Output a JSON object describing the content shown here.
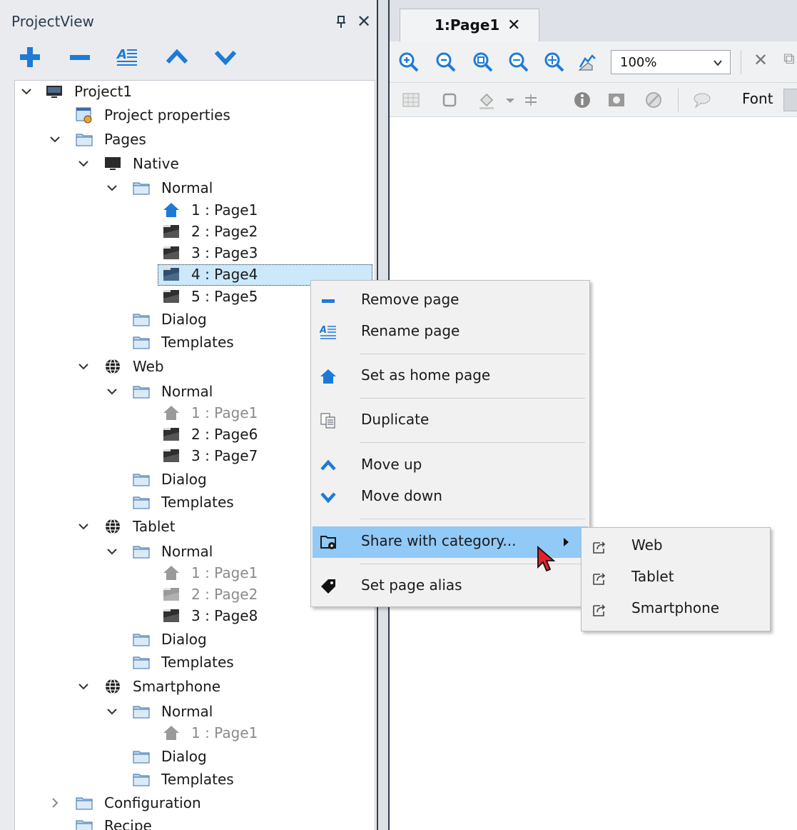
{
  "project_view": {
    "title": "ProjectView",
    "toolbar": [
      "add",
      "remove",
      "rename",
      "move-up",
      "move-down"
    ]
  },
  "tree": [
    {
      "label": "Project1",
      "dim": false
    },
    {
      "label": "Project properties",
      "dim": false
    },
    {
      "label": "Pages",
      "dim": false
    },
    {
      "label": "Native",
      "dim": false
    },
    {
      "label": "Normal",
      "dim": false
    },
    {
      "label": "1 : Page1",
      "dim": false
    },
    {
      "label": "2 : Page2",
      "dim": false
    },
    {
      "label": "3 : Page3",
      "dim": false
    },
    {
      "label": "4 : Page4",
      "dim": false,
      "selected": true
    },
    {
      "label": "5 : Page5",
      "dim": false
    },
    {
      "label": "Dialog",
      "dim": false
    },
    {
      "label": "Templates",
      "dim": false
    },
    {
      "label": "Web",
      "dim": false
    },
    {
      "label": "Normal",
      "dim": false
    },
    {
      "label": "1 : Page1",
      "dim": true
    },
    {
      "label": "2 : Page6",
      "dim": false
    },
    {
      "label": "3 : Page7",
      "dim": false
    },
    {
      "label": "Dialog",
      "dim": false
    },
    {
      "label": "Templates",
      "dim": false
    },
    {
      "label": "Tablet",
      "dim": false
    },
    {
      "label": "Normal",
      "dim": false
    },
    {
      "label": "1 : Page1",
      "dim": true
    },
    {
      "label": "2 : Page2",
      "dim": true
    },
    {
      "label": "3 : Page8",
      "dim": false
    },
    {
      "label": "Dialog",
      "dim": false
    },
    {
      "label": "Templates",
      "dim": false
    },
    {
      "label": "Smartphone",
      "dim": false
    },
    {
      "label": "Normal",
      "dim": false
    },
    {
      "label": "1 : Page1",
      "dim": true
    },
    {
      "label": "Dialog",
      "dim": false
    },
    {
      "label": "Templates",
      "dim": false
    },
    {
      "label": "Configuration",
      "dim": false
    },
    {
      "label": "Recipe",
      "dim": false
    }
  ],
  "editor": {
    "tab_label": "1:Page1",
    "zoom_value": "100%",
    "font_label": "Font"
  },
  "context_menu": {
    "items": [
      {
        "label": "Remove page",
        "icon": "minus-icon"
      },
      {
        "label": "Rename page",
        "icon": "rename-icon"
      },
      {
        "label": "Set as home page",
        "icon": "home-icon"
      },
      {
        "label": "Duplicate",
        "icon": "duplicate-icon"
      },
      {
        "label": "Move up",
        "icon": "chevron-up-icon"
      },
      {
        "label": "Move down",
        "icon": "chevron-down-icon"
      },
      {
        "label": "Share with category...",
        "icon": "share-folder-icon",
        "highlighted": true
      },
      {
        "label": "Set page alias",
        "icon": "tag-icon"
      }
    ]
  },
  "submenu": {
    "items": [
      "Web",
      "Tablet",
      "Smartphone"
    ]
  },
  "colors": {
    "accent_blue": "#1e7ad7",
    "highlight": "#91c9f7",
    "selection": "#cce8fb"
  }
}
